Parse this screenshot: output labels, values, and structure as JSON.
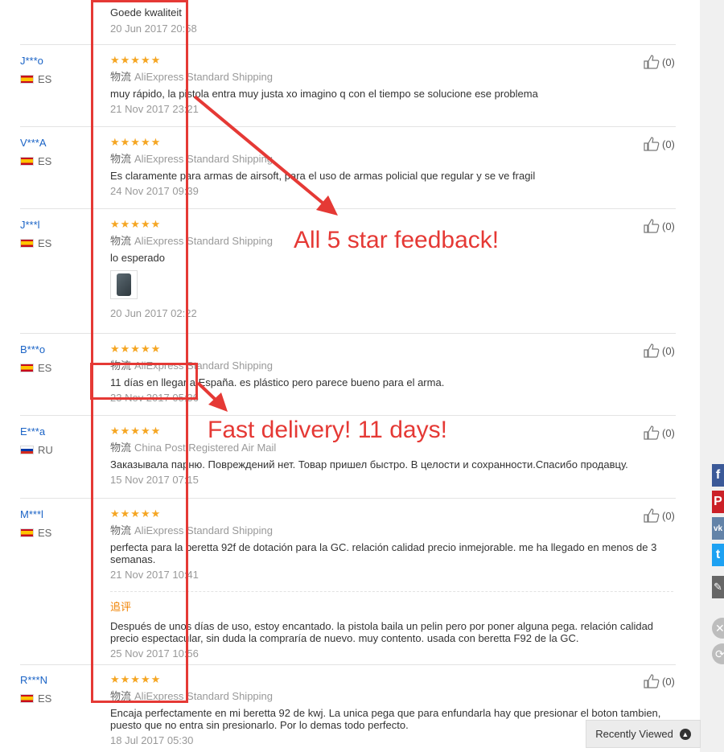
{
  "top_partial": {
    "text": "Goede kwaliteit",
    "date": "20 Jun 2017 20:58"
  },
  "reviews": [
    {
      "buyer": "J***o",
      "country": "ES",
      "flag": "es",
      "stars": "★★★★★",
      "logistics_label": "物流",
      "shipping": "AliExpress Standard Shipping",
      "text": "muy rápido, la pistola entra muy justa xo imagino q con el tiempo se solucione ese problema",
      "date": "21 Nov 2017 23:21",
      "helpful": "(0)"
    },
    {
      "buyer": "V***A",
      "country": "ES",
      "flag": "es",
      "stars": "★★★★★",
      "logistics_label": "物流",
      "shipping": "AliExpress Standard Shipping",
      "text": "Es claramente para armas de airsoft, para el uso de armas policial que regular y se ve fragil",
      "date": "24 Nov 2017 09:39",
      "helpful": "(0)"
    },
    {
      "buyer": "J***l",
      "country": "ES",
      "flag": "es",
      "stars": "★★★★★",
      "logistics_label": "物流",
      "shipping": "AliExpress Standard Shipping",
      "text": "lo esperado",
      "date": "20 Jun 2017 02:22",
      "helpful": "(0)"
    },
    {
      "buyer": "B***o",
      "country": "ES",
      "flag": "es",
      "stars": "★★★★★",
      "logistics_label": "物流",
      "shipping": "AliExpress Standard Shipping",
      "text": "11 días en llegar a España. es plástico pero parece bueno para el arma.",
      "date": "23 Nov 2017 05:36",
      "helpful": "(0)"
    },
    {
      "buyer": "E***a",
      "country": "RU",
      "flag": "ru",
      "stars": "★★★★★",
      "logistics_label": "物流",
      "shipping": "China Post Registered Air Mail",
      "text": "Заказывала парню. Повреждений нет. Товар пришел быстро. В целости и сохранности.Спасибо продавцу.",
      "date": "15 Nov 2017 07:15",
      "helpful": "(0)"
    },
    {
      "buyer": "M***l",
      "country": "ES",
      "flag": "es",
      "stars": "★★★★★",
      "logistics_label": "物流",
      "shipping": "AliExpress Standard Shipping",
      "text": "perfecta para la beretta 92f de dotación para la GC. relación calidad precio inmejorable. me ha llegado en menos de 3 semanas.",
      "date": "21 Nov 2017 10:41",
      "helpful": "(0)",
      "followup_label": "追评",
      "followup_text": "Después de unos días de uso, estoy encantado. la pistola baila un pelin pero por poner alguna pega. relación calidad precio espectacular, sin duda la compraría de nuevo. muy contento. usada con beretta F92 de la GC.",
      "followup_date": "25 Nov 2017 10:56"
    },
    {
      "buyer": "R***N",
      "country": "ES",
      "flag": "es",
      "stars": "★★★★★",
      "logistics_label": "物流",
      "shipping": "AliExpress Standard Shipping",
      "text": "Encaja perfectamente en mi beretta 92 de kwj. La unica pega que para enfundarla hay que presionar el boton tambien, puesto que no entra sin presionarlo. Por lo demas todo perfecto.",
      "date": "18 Jul 2017 05:30",
      "helpful": "(0)"
    }
  ],
  "annotations": {
    "stars_note": "All 5 star feedback!",
    "delivery_note": "Fast delivery! 11 days!",
    "color": "#e53935"
  },
  "share": {
    "facebook": "f",
    "pinterest": "P",
    "vk": "vk",
    "twitter": "t",
    "edit": "✎",
    "close": "✕",
    "more": "⟳"
  },
  "recently_viewed": {
    "label": "Recently Viewed",
    "icon": "chevron-up-icon"
  },
  "colors": {
    "name_link": "#1a63c6",
    "star": "#f5a623",
    "followup": "#f08200",
    "facebook": "#3b5998",
    "pinterest": "#cb2027",
    "vk": "#6383a8",
    "twitter": "#1da1f2",
    "edit": "#666666"
  }
}
